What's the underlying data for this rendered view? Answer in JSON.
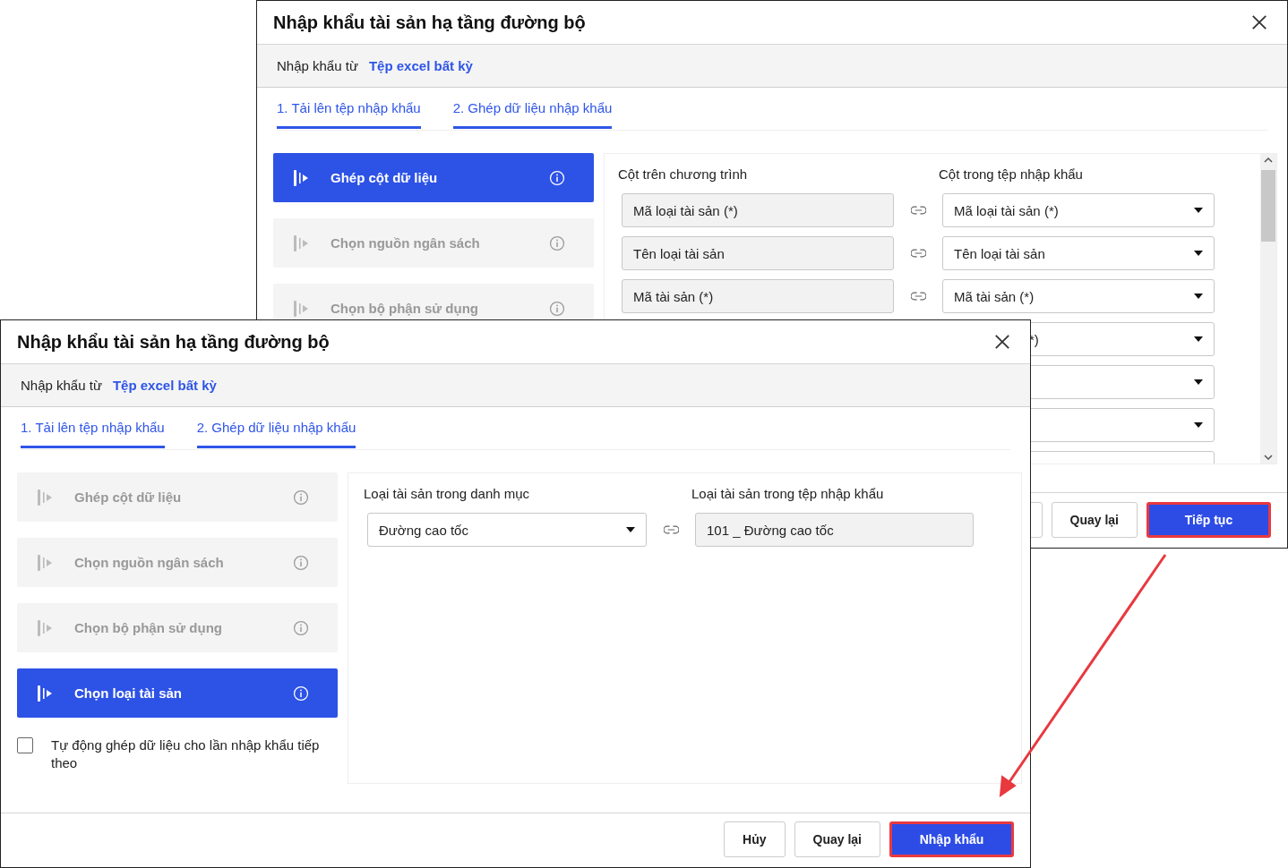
{
  "dialogs": [
    {
      "title": "Nhập khẩu tài sản hạ tầng đường bộ",
      "source_label": "Nhập khẩu từ",
      "source_value": "Tệp excel bất kỳ",
      "tabs": [
        {
          "label": "1. Tải lên tệp nhập khẩu",
          "selected": true
        },
        {
          "label": "2. Ghép dữ liệu nhập khẩu",
          "selected": true
        }
      ],
      "steps": [
        {
          "label": "Ghép cột dữ liệu",
          "selected": true
        },
        {
          "label": "Chọn nguồn ngân sách",
          "selected": false
        },
        {
          "label": "Chọn bộ phận sử dụng",
          "selected": false
        }
      ],
      "mapping": {
        "left_header": "Cột trên chương trình",
        "right_header": "Cột trong tệp nhập khẩu",
        "scrollable": true,
        "rows": [
          {
            "kind": "column",
            "program_column": "Mã loại tài sản (*)",
            "file_column": "Mã loại tài sản (*)"
          },
          {
            "kind": "column",
            "program_column": "Tên loại tài sản",
            "file_column": "Tên loại tài sản"
          },
          {
            "kind": "column",
            "program_column": "Mã tài sản (*)",
            "file_column": "Mã tài sản (*)"
          },
          {
            "kind": "partial",
            "file_column": "*)"
          },
          {
            "kind": "partial"
          },
          {
            "kind": "partial"
          },
          {
            "kind": "clipped"
          }
        ]
      },
      "buttons": [
        {
          "kind": "secondary",
          "highlighted": false
        },
        {
          "kind": "secondary",
          "label": "Quay lại",
          "highlighted": false
        },
        {
          "kind": "primary",
          "label": "Tiếp tục",
          "highlighted": true
        }
      ]
    },
    {
      "title": "Nhập khẩu tài sản hạ tầng đường bộ",
      "source_label": "Nhập khẩu từ",
      "source_value": "Tệp excel bất kỳ",
      "tabs": [
        {
          "label": "1. Tải lên tệp nhập khẩu",
          "selected": true
        },
        {
          "label": "2. Ghép dữ liệu nhập khẩu",
          "selected": true
        }
      ],
      "steps": [
        {
          "label": "Ghép cột dữ liệu",
          "selected": false
        },
        {
          "label": "Chọn nguồn ngân sách",
          "selected": false
        },
        {
          "label": "Chọn bộ phận sử dụng",
          "selected": false
        },
        {
          "label": "Chọn loại tài sản",
          "selected": true
        }
      ],
      "auto_match": {
        "label": "Tự động ghép dữ liệu cho lần nhập khẩu tiếp theo",
        "checked": false
      },
      "mapping": {
        "left_header": "Loại tài sản trong danh mục",
        "right_header": "Loại tài sản trong tệp nhập khẩu",
        "rows": [
          {
            "kind": "category",
            "program_value": "Đường cao tốc",
            "file_value": "101 _ Đường cao tốc"
          }
        ]
      },
      "buttons": [
        {
          "kind": "secondary",
          "label": "Hủy",
          "highlighted": false
        },
        {
          "kind": "secondary",
          "label": "Quay lại",
          "highlighted": false
        },
        {
          "kind": "primary",
          "label": "Nhập khẩu",
          "highlighted": true
        }
      ]
    }
  ]
}
